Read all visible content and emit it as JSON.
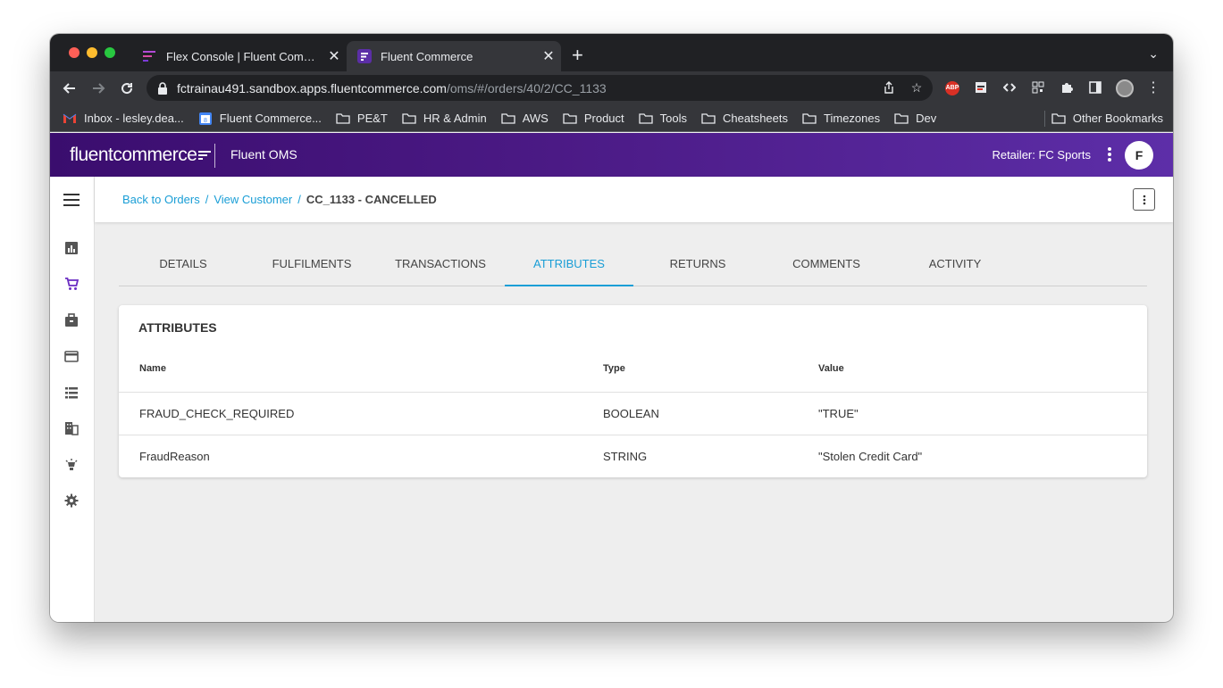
{
  "browser": {
    "tabs": [
      {
        "title": "Flex Console | Fluent Commerce",
        "active": false
      },
      {
        "title": "Fluent Commerce",
        "active": true
      }
    ],
    "url_host": "fctrainau491.sandbox.apps.fluentcommerce.com",
    "url_path": "/oms/#/orders/40/2/CC_1133",
    "extensions": [
      "ABP"
    ],
    "bookmarks": [
      {
        "label": "Inbox - lesley.dea...",
        "icon": "gmail-icon"
      },
      {
        "label": "Fluent Commerce...",
        "icon": "calendar-icon"
      },
      {
        "label": "PE&T",
        "icon": "folder-icon"
      },
      {
        "label": "HR & Admin",
        "icon": "folder-icon"
      },
      {
        "label": "AWS",
        "icon": "folder-icon"
      },
      {
        "label": "Product",
        "icon": "folder-icon"
      },
      {
        "label": "Tools",
        "icon": "folder-icon"
      },
      {
        "label": "Cheatsheets",
        "icon": "folder-icon"
      },
      {
        "label": "Timezones",
        "icon": "folder-icon"
      },
      {
        "label": "Dev",
        "icon": "folder-icon"
      }
    ],
    "other_bookmarks": "Other Bookmarks"
  },
  "app": {
    "logo_text": "fluentcommerce",
    "name": "Fluent OMS",
    "retailer": "Retailer: FC Sports",
    "avatar_initial": "F",
    "brand_color": "#3a0d6e",
    "accent_color": "#1a9ed6"
  },
  "breadcrumb": {
    "items": [
      "Back to Orders",
      "View Customer"
    ],
    "current": "CC_1133 - CANCELLED"
  },
  "tabs": [
    "DETAILS",
    "FULFILMENTS",
    "TRANSACTIONS",
    "ATTRIBUTES",
    "RETURNS",
    "COMMENTS",
    "ACTIVITY"
  ],
  "selected_tab": "ATTRIBUTES",
  "attributes": {
    "title": "ATTRIBUTES",
    "columns": [
      "Name",
      "Type",
      "Value"
    ],
    "rows": [
      {
        "name": "FRAUD_CHECK_REQUIRED",
        "type": "BOOLEAN",
        "value": "\"TRUE\""
      },
      {
        "name": "FraudReason",
        "type": "STRING",
        "value": "\"Stolen Credit Card\""
      }
    ]
  }
}
